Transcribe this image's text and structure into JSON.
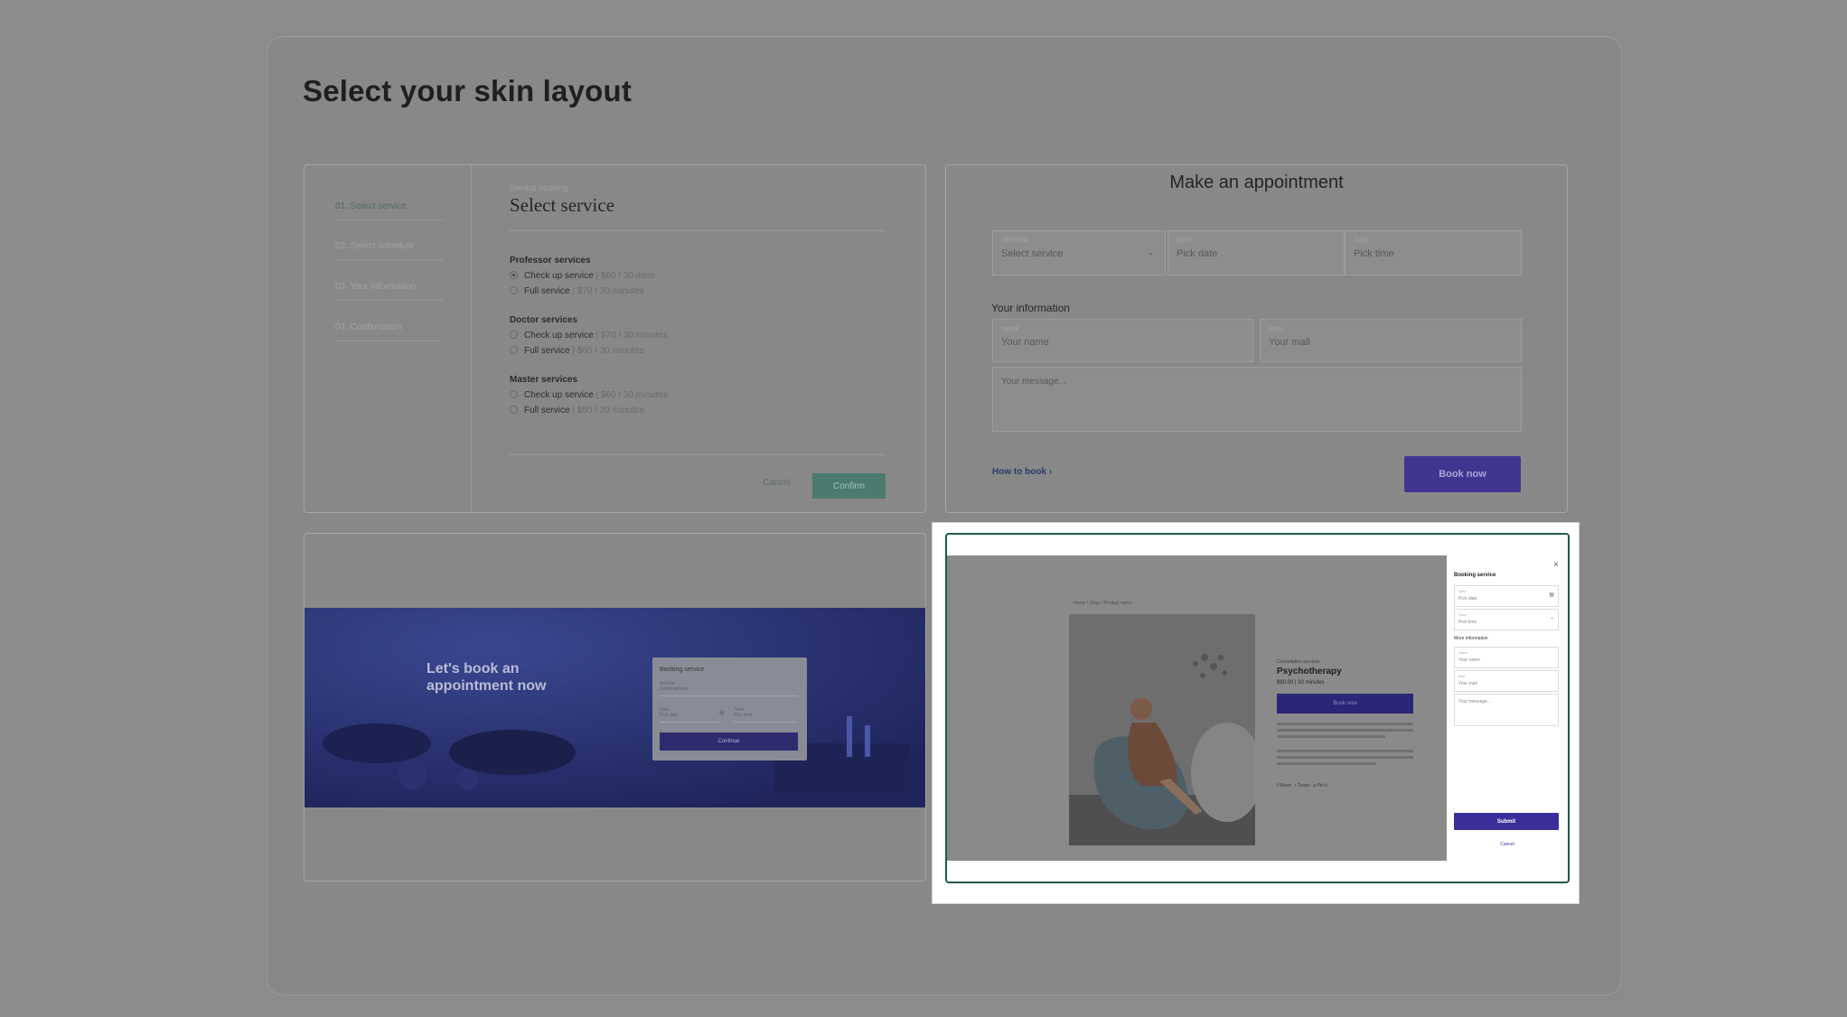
{
  "page": {
    "title": "Select your skin layout"
  },
  "layout1": {
    "steps": [
      "01. Select service",
      "02. Select schedule",
      "03. Your information",
      "04. Confirmation"
    ],
    "subtitle": "Service booking",
    "title": "Select service",
    "groups": [
      {
        "name": "Professor services",
        "options": [
          {
            "label": "Check up service",
            "price": "| $80 / 30 mins",
            "selected": true
          },
          {
            "label": "Full service",
            "price": "| $70 / 30 minutes",
            "selected": false
          }
        ]
      },
      {
        "name": "Doctor services",
        "options": [
          {
            "label": "Check up service",
            "price": "| $70 / 30 minutes",
            "selected": false
          },
          {
            "label": "Full service",
            "price": "| $60 / 30 minutes",
            "selected": false
          }
        ]
      },
      {
        "name": "Master services",
        "options": [
          {
            "label": "Check up service",
            "price": "| $60 / 30 minutes",
            "selected": false
          },
          {
            "label": "Full service",
            "price": "| $50 / 30 minutes",
            "selected": false
          }
        ]
      }
    ],
    "cancel": "Cancel",
    "confirm": "Confirm"
  },
  "layout2": {
    "title": "Make an appointment",
    "service_label": "SERVICE",
    "service_value": "Select service",
    "date_label": "DATE",
    "date_value": "Pick date",
    "time_label": "TIME",
    "time_value": "Pick time",
    "info_heading": "Your information",
    "name_label": "NAME",
    "name_value": "Your name",
    "mail_label": "MAIL",
    "mail_value": "Your mail",
    "message_placeholder": "Your message...",
    "how_to": "How to book",
    "book_now": "Book now"
  },
  "layout3": {
    "headline_line1": "Let's book an",
    "headline_line2": "appointment now",
    "booking_title": "Booking service",
    "service_label": "Service",
    "service_value": "Select service",
    "date_label": "Date",
    "date_value": "Pick date",
    "time_label": "Time",
    "time_value": "Pick time",
    "continue": "Continue"
  },
  "layout4": {
    "breadcrumb": "Home / Shop / Product name",
    "category": "Consultation services",
    "product_name": "Psychotherapy",
    "price": "$90.00 | 30 minutes",
    "book_now": "Book now",
    "share": "Share",
    "tweet": "Tweet",
    "pin": "Pin it",
    "panel_title": "Booking service",
    "date_label": "Date",
    "date_value": "Pick date",
    "time_label": "Time",
    "time_value": "Pick time",
    "more_info": "More information",
    "name_label": "Name",
    "name_value": "Your name",
    "mail_label": "Mail",
    "mail_value": "Your mail",
    "message_placeholder": "Your message...",
    "submit": "Submit",
    "cancel": "Cancel",
    "close": "×"
  }
}
